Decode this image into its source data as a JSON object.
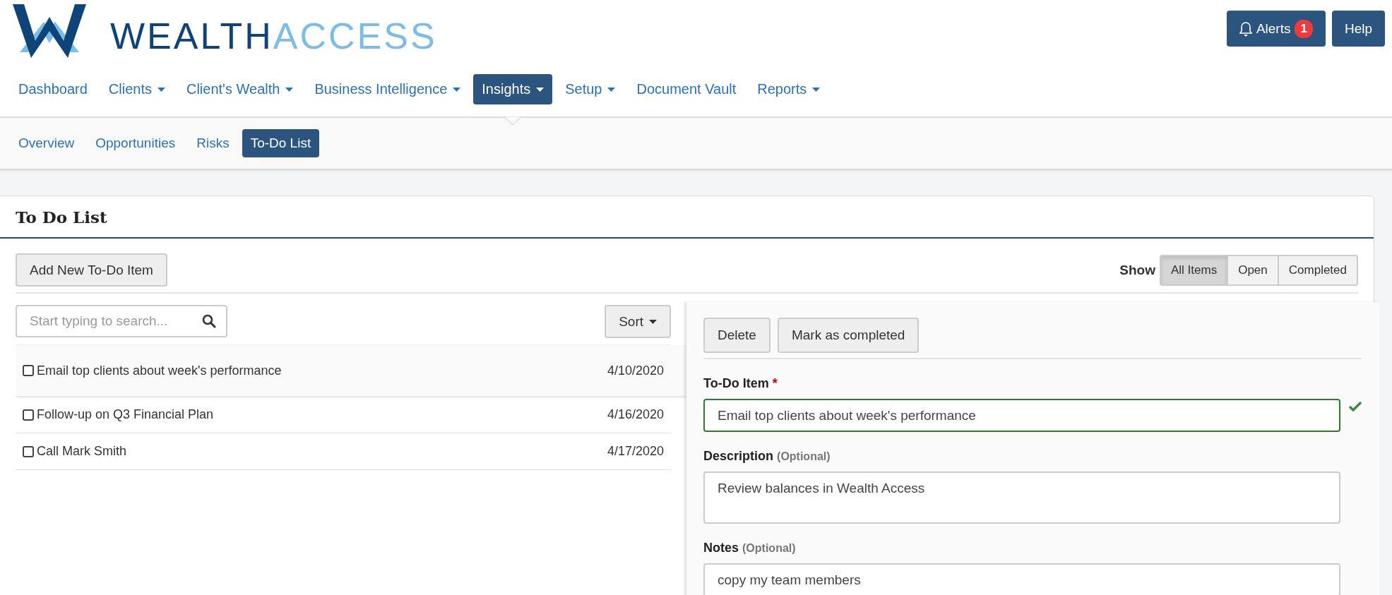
{
  "logo": {
    "text_1": "WEALTH",
    "text_2": "ACCESS"
  },
  "header_actions": {
    "alerts": {
      "label": "Alerts",
      "count": "1"
    },
    "help": "Help"
  },
  "nav": [
    {
      "label": "Dashboard",
      "dropdown": false,
      "selected": false
    },
    {
      "label": "Clients",
      "dropdown": true,
      "selected": false
    },
    {
      "label": "Client's Wealth",
      "dropdown": true,
      "selected": false
    },
    {
      "label": "Business Intelligence",
      "dropdown": true,
      "selected": false
    },
    {
      "label": "Insights",
      "dropdown": true,
      "selected": true
    },
    {
      "label": "Setup",
      "dropdown": true,
      "selected": false
    },
    {
      "label": "Document Vault",
      "dropdown": false,
      "selected": false
    },
    {
      "label": "Reports",
      "dropdown": true,
      "selected": false
    }
  ],
  "subnav": [
    {
      "label": "Overview",
      "selected": false
    },
    {
      "label": "Opportunities",
      "selected": false
    },
    {
      "label": "Risks",
      "selected": false
    },
    {
      "label": "To-Do List",
      "selected": true
    }
  ],
  "card": {
    "title": "To Do List",
    "add_button": "Add New To-Do Item",
    "show_label": "Show",
    "filters": [
      {
        "label": "All Items",
        "selected": true
      },
      {
        "label": "Open",
        "selected": false
      },
      {
        "label": "Completed",
        "selected": false
      }
    ],
    "search": {
      "placeholder": "Start typing to search..."
    },
    "sort_button": "Sort",
    "todos": [
      {
        "title": "Email top clients about week's performance",
        "date": "4/10/2020",
        "checked": false,
        "selected": true
      },
      {
        "title": "Follow-up on Q3 Financial Plan",
        "date": "4/16/2020",
        "checked": false,
        "selected": false
      },
      {
        "title": "Call Mark Smith",
        "date": "4/17/2020",
        "checked": false,
        "selected": false
      }
    ],
    "detail": {
      "buttons": [
        "Delete",
        "Mark as completed"
      ],
      "fields": [
        {
          "kind": "input",
          "label": "To-Do Item",
          "required_mark": "*",
          "value": "Email top clients about week's performance",
          "valid": true
        },
        {
          "kind": "textarea",
          "label": "Description",
          "hint": "(Optional)",
          "value": "Review balances in Wealth Access",
          "valid": false
        },
        {
          "kind": "input",
          "label": "Notes",
          "hint": "(Optional)",
          "value": "copy my team members",
          "valid": false
        }
      ]
    }
  }
}
